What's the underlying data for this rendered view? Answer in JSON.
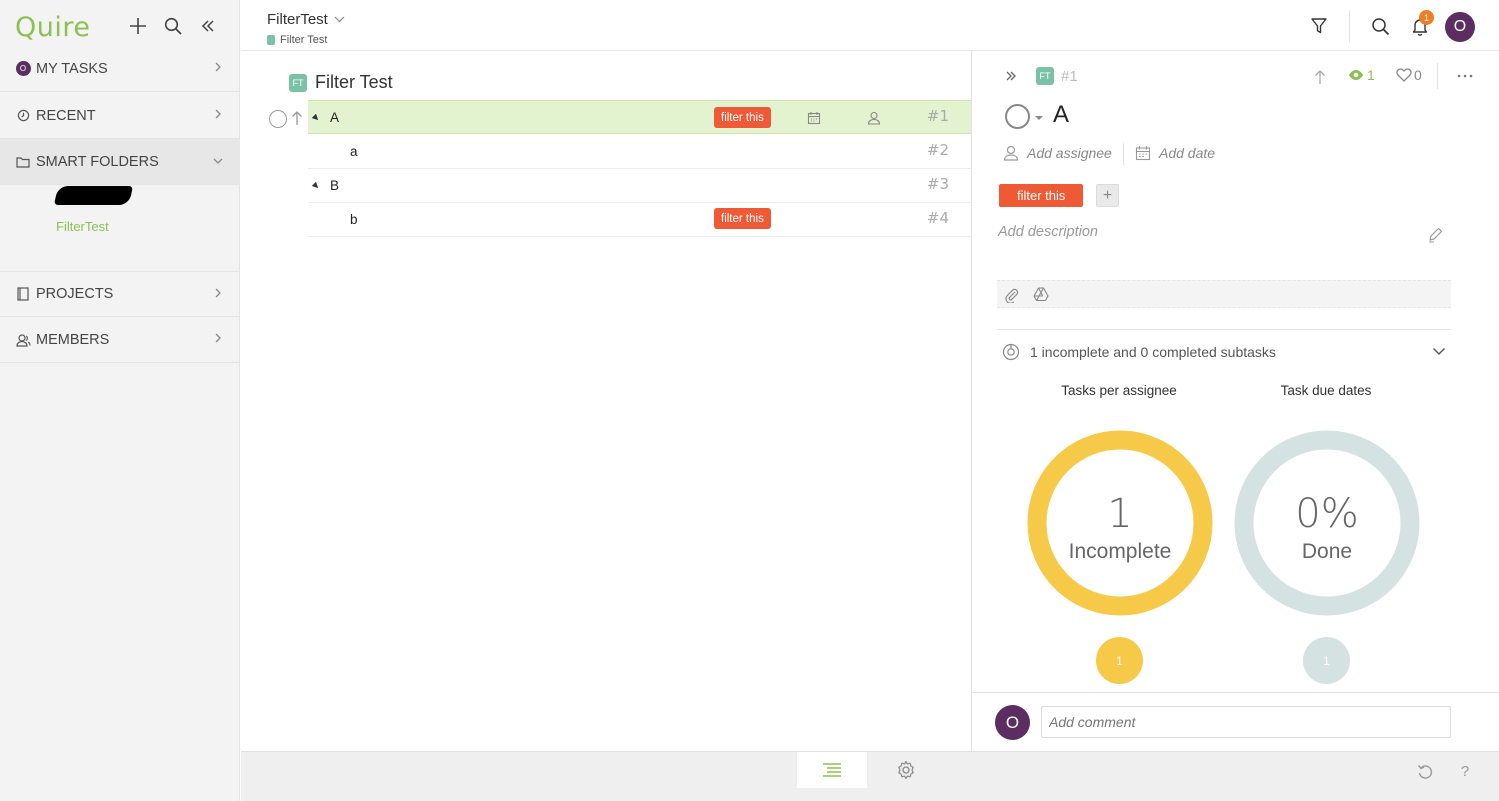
{
  "app": {
    "logo": "Quire"
  },
  "sidebar": {
    "my_tasks": {
      "label": "MY TASKS",
      "avatar_letter": "O"
    },
    "recent": {
      "label": "RECENT"
    },
    "smart_folders": {
      "label": "SMART FOLDERS",
      "items": [
        "FilterTest"
      ]
    },
    "projects": {
      "label": "PROJECTS"
    },
    "members": {
      "label": "MEMBERS"
    }
  },
  "header": {
    "title": "FilterTest",
    "subtitle": "Filter Test",
    "notification_count": "1",
    "user_avatar": "O"
  },
  "task_list": {
    "project_badge": "FT",
    "project_title": "Filter Test",
    "rows": [
      {
        "name": "A",
        "num": "#1",
        "tag": "filter this",
        "selected": true,
        "expandable": true
      },
      {
        "name": "a",
        "num": "#2",
        "tag": "",
        "selected": false,
        "expandable": false
      },
      {
        "name": "B",
        "num": "#3",
        "tag": "",
        "selected": false,
        "expandable": true
      },
      {
        "name": "b",
        "num": "#4",
        "tag": "filter this",
        "selected": false,
        "expandable": false
      }
    ]
  },
  "detail": {
    "badge": "FT",
    "task_num": "#1",
    "watchers": "1",
    "likes": "0",
    "title": "A",
    "add_assignee": "Add assignee",
    "add_date": "Add date",
    "tag": "filter this",
    "add_tag": "+",
    "description_placeholder": "Add description",
    "subtasks_summary": "1 incomplete and 0 completed subtasks",
    "charts": [
      {
        "title": "Tasks per assignee",
        "big": "1",
        "small": "Incomplete",
        "legend_value": "1",
        "color": "#f7c948"
      },
      {
        "title": "Task due dates",
        "big": "0%",
        "small": "Done",
        "legend_value": "1",
        "color": "#d5e2e2"
      }
    ],
    "comment_avatar": "O",
    "comment_placeholder": "Add comment"
  },
  "colors": {
    "brand": "#8cc152",
    "tag": "#ee5a35",
    "selected_row": "#e4f3cf",
    "avatar": "#5c2d60",
    "badge": "#79c2a8"
  }
}
